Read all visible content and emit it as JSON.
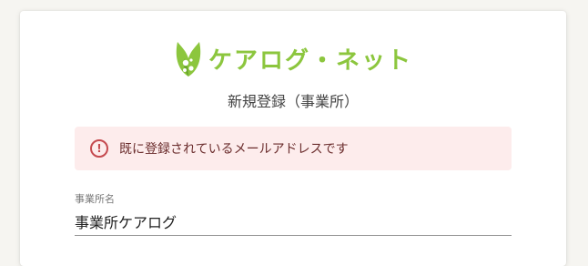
{
  "brand": {
    "name": "ケアログ・ネット",
    "icon": "leaf-logo-icon",
    "color": "#8cc63e"
  },
  "page": {
    "subtitle": "新規登録（事業所）"
  },
  "alert": {
    "icon": "exclamation-circle-icon",
    "glyph": "!",
    "message": "既に登録されているメールアドレスです",
    "background": "#fdecec",
    "icon_color": "#c54a4f"
  },
  "form": {
    "office_name": {
      "label": "事業所名",
      "value": "事業所ケアログ"
    }
  }
}
